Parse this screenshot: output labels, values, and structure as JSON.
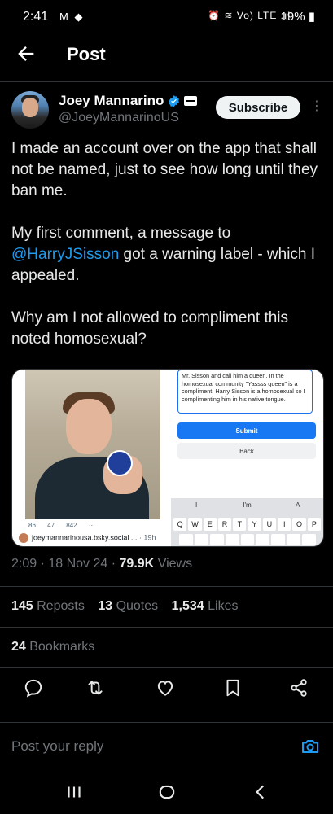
{
  "status_bar": {
    "time": "2:41",
    "left_icons": "M ◆",
    "right_icons": "⏰ ≋ Vo) LTE .ıl",
    "battery": "19%",
    "icon_names": [
      "gmail-icon",
      "bag-icon",
      "alarm-icon",
      "wifi-icon",
      "signal-icon",
      "battery-icon"
    ]
  },
  "header": {
    "title": "Post",
    "back_icon": "back-arrow-icon"
  },
  "author": {
    "name": "Joey Mannarino",
    "handle": "@JoeyMannarinoUS",
    "subscribe_label": "Subscribe",
    "more_glyph": "⋮"
  },
  "tweet": {
    "p1": "I made an account over on the app that shall not be named, just to see how long until they ban me.",
    "p2_before": "My first comment, a message to",
    "p2_mention": "@HarryJSisson",
    "p2_after": "got a warning label - which I appealed.",
    "p3": "Why am I not allowed to compliment this noted homosexual?"
  },
  "media": {
    "left": {
      "stats": "86 47 842 ···",
      "source": "joeymannarinousa.bsky.social ...",
      "ago": "· 19h"
    },
    "right": {
      "appeal_text": "Mr. Sisson and call him a queen. In the homosexual community \"Yassss queen\" is a compliment. Harry Sisson is a homosexual so I complimenting him in his native tongue.",
      "submit_label": "Submit",
      "back_label": "Back",
      "suggestions": [
        "I",
        "I'm",
        "A"
      ],
      "keys": [
        "Q",
        "W",
        "E",
        "R",
        "T",
        "Y",
        "U",
        "I",
        "O",
        "P"
      ]
    }
  },
  "meta": {
    "time_date": "2:09 · 18 Nov 24 ·",
    "views_count": "79.9K",
    "views_label": "Views"
  },
  "engagement": {
    "reposts_count": "145",
    "reposts_label": "Reposts",
    "quotes_count": "13",
    "quotes_label": "Quotes",
    "likes_count": "1,534",
    "likes_label": "Likes",
    "bookmarks_count": "24",
    "bookmarks_label": "Bookmarks"
  },
  "reply": {
    "placeholder": "Post your reply"
  },
  "colors": {
    "background": "#000000",
    "accent": "#1d9bf0",
    "muted": "#71767b",
    "divider": "#2f3336"
  }
}
